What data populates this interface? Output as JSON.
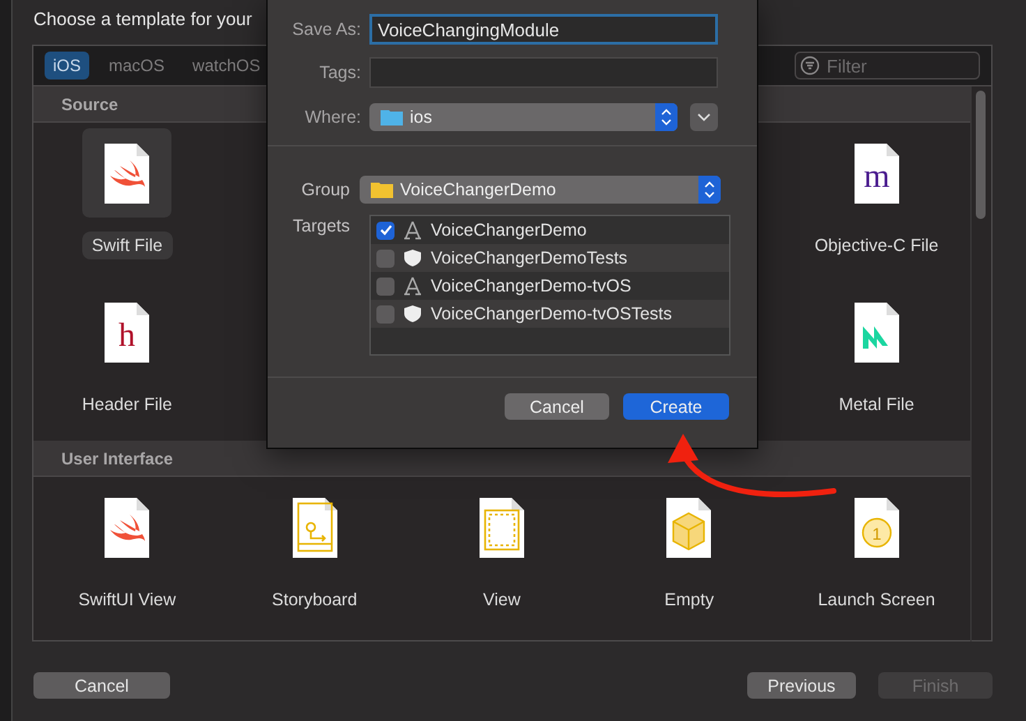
{
  "title": "Choose a template for your",
  "platform_tabs": [
    {
      "label": "iOS",
      "selected": true
    },
    {
      "label": "macOS",
      "selected": false
    },
    {
      "label": "watchOS",
      "selected": false
    }
  ],
  "filter": {
    "placeholder": "Filter"
  },
  "sections": [
    {
      "title": "Source",
      "rows": [
        [
          {
            "label": "Swift File",
            "kind": "swift",
            "selected": true
          },
          "",
          "",
          "",
          {
            "label": "Objective-C File",
            "kind": "letter",
            "glyph": "m",
            "selected": false
          }
        ],
        [
          {
            "label": "Header File",
            "kind": "letter",
            "glyph": "h",
            "selected": false
          },
          "",
          "",
          "",
          {
            "label": "Metal File",
            "kind": "metal",
            "selected": false
          }
        ]
      ]
    },
    {
      "title": "User Interface",
      "rows": [
        [
          {
            "label": "SwiftUI View",
            "kind": "swift",
            "selected": false
          },
          {
            "label": "Storyboard",
            "kind": "storyboard",
            "selected": false
          },
          {
            "label": "View",
            "kind": "view",
            "selected": false
          },
          {
            "label": "Empty",
            "kind": "cube",
            "selected": false
          },
          {
            "label": "Launch Screen",
            "kind": "launch",
            "glyph": "1",
            "selected": false
          }
        ]
      ]
    }
  ],
  "sheet": {
    "save_as": {
      "label": "Save As:",
      "value": "VoiceChangingModule"
    },
    "tags": {
      "label": "Tags:"
    },
    "where": {
      "label": "Where:",
      "value": "ios"
    },
    "group": {
      "label": "Group",
      "value": "VoiceChangerDemo"
    },
    "targets": {
      "label": "Targets",
      "items": [
        {
          "name": "VoiceChangerDemo",
          "kind": "app",
          "checked": true
        },
        {
          "name": "VoiceChangerDemoTests",
          "kind": "test",
          "checked": false
        },
        {
          "name": "VoiceChangerDemo-tvOS",
          "kind": "app",
          "checked": false
        },
        {
          "name": "VoiceChangerDemo-tvOSTests",
          "kind": "test",
          "checked": false
        }
      ]
    },
    "buttons": [
      {
        "label": "Cancel",
        "kind": "secondary"
      },
      {
        "label": "Create",
        "kind": "primary"
      }
    ]
  },
  "footer_buttons": [
    {
      "label": "Cancel",
      "disabled": false
    },
    {
      "label": "Previous",
      "disabled": false
    },
    {
      "label": "Finish",
      "disabled": true
    }
  ]
}
